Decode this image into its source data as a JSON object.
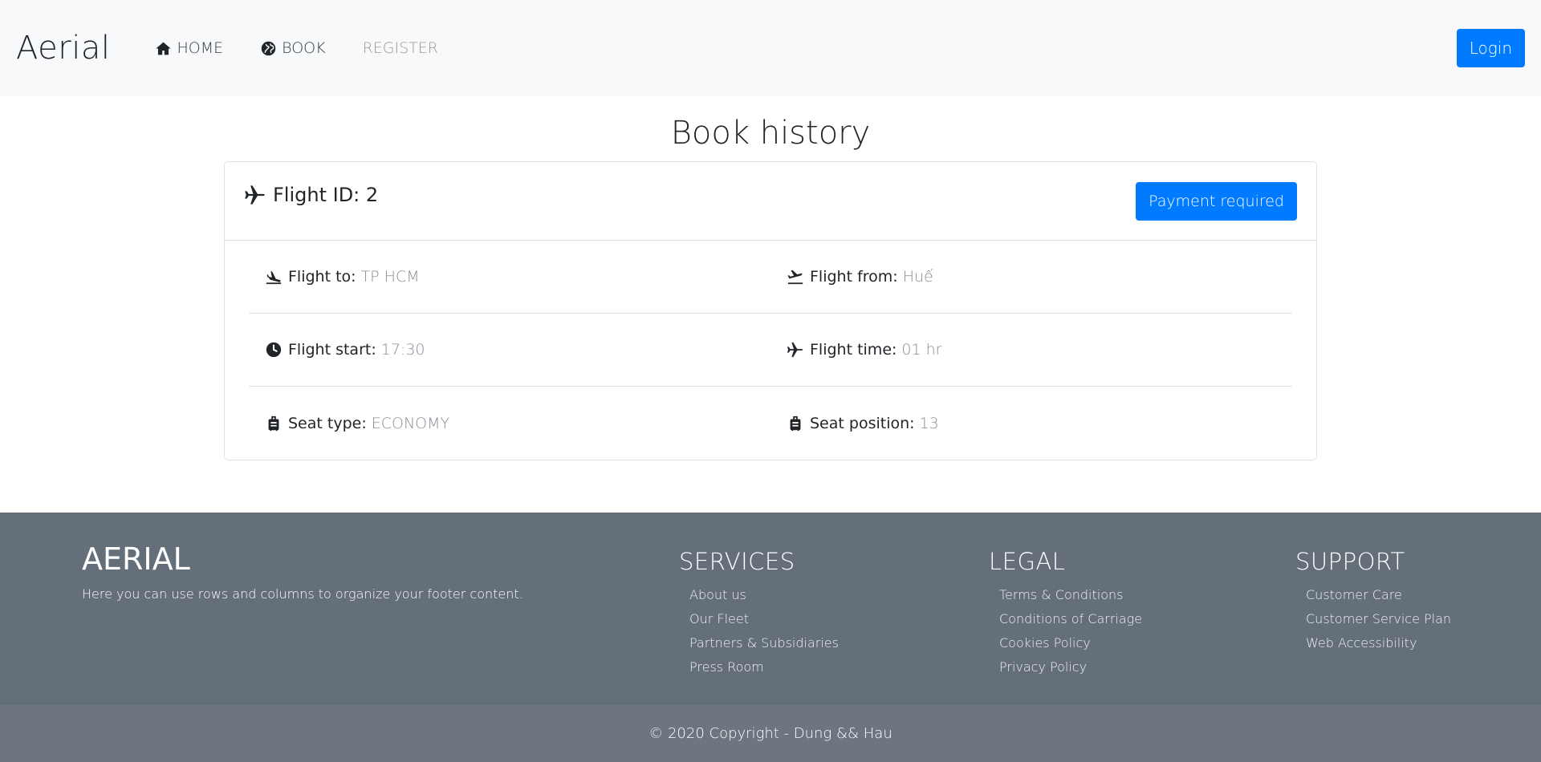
{
  "navbar": {
    "brand": "Aerial",
    "links": [
      {
        "label": "HOME",
        "icon": "home-icon"
      },
      {
        "label": "BOOK",
        "icon": "globe-icon"
      },
      {
        "label": "REGISTER",
        "icon": ""
      }
    ],
    "login_label": "Login"
  },
  "main": {
    "title": "Book history",
    "booking": {
      "flight_id": "Flight ID: 2",
      "status": "Payment required",
      "fields": [
        {
          "label": "Flight to:",
          "value": "TP HCM",
          "icon": "plane-landing-icon"
        },
        {
          "label": "Flight from:",
          "value": "Huế",
          "icon": "plane-departure-icon"
        },
        {
          "label": "Flight start:",
          "value": "17:30",
          "icon": "clock-icon"
        },
        {
          "label": "Flight time:",
          "value": "01 hr",
          "icon": "plane-icon"
        },
        {
          "label": "Seat type:",
          "value": "ECONOMY",
          "icon": "suitcase-icon"
        },
        {
          "label": "Seat position:",
          "value": "13",
          "icon": "suitcase-icon"
        }
      ]
    }
  },
  "footer": {
    "brand": "AERIAL",
    "description": "Here you can use rows and columns to organize your footer content.",
    "columns": [
      {
        "title": "SERVICES",
        "items": [
          "About us",
          "Our Fleet",
          "Partners & Subsidiaries",
          "Press Room"
        ]
      },
      {
        "title": "LEGAL",
        "items": [
          "Terms & Conditions",
          "Conditions of Carriage",
          "Cookies Policy",
          "Privacy Policy"
        ]
      },
      {
        "title": "SUPPORT",
        "items": [
          "Customer Care",
          "Customer Service Plan",
          "Web Accessibility"
        ]
      }
    ],
    "copyright": "© 2020 Copyright - Dung && Hau"
  },
  "colors": {
    "accent": "#007bff",
    "navbar_bg": "#f8f9fa",
    "footer_bg": "#646f7a",
    "copyright_bg": "#6c7580"
  }
}
